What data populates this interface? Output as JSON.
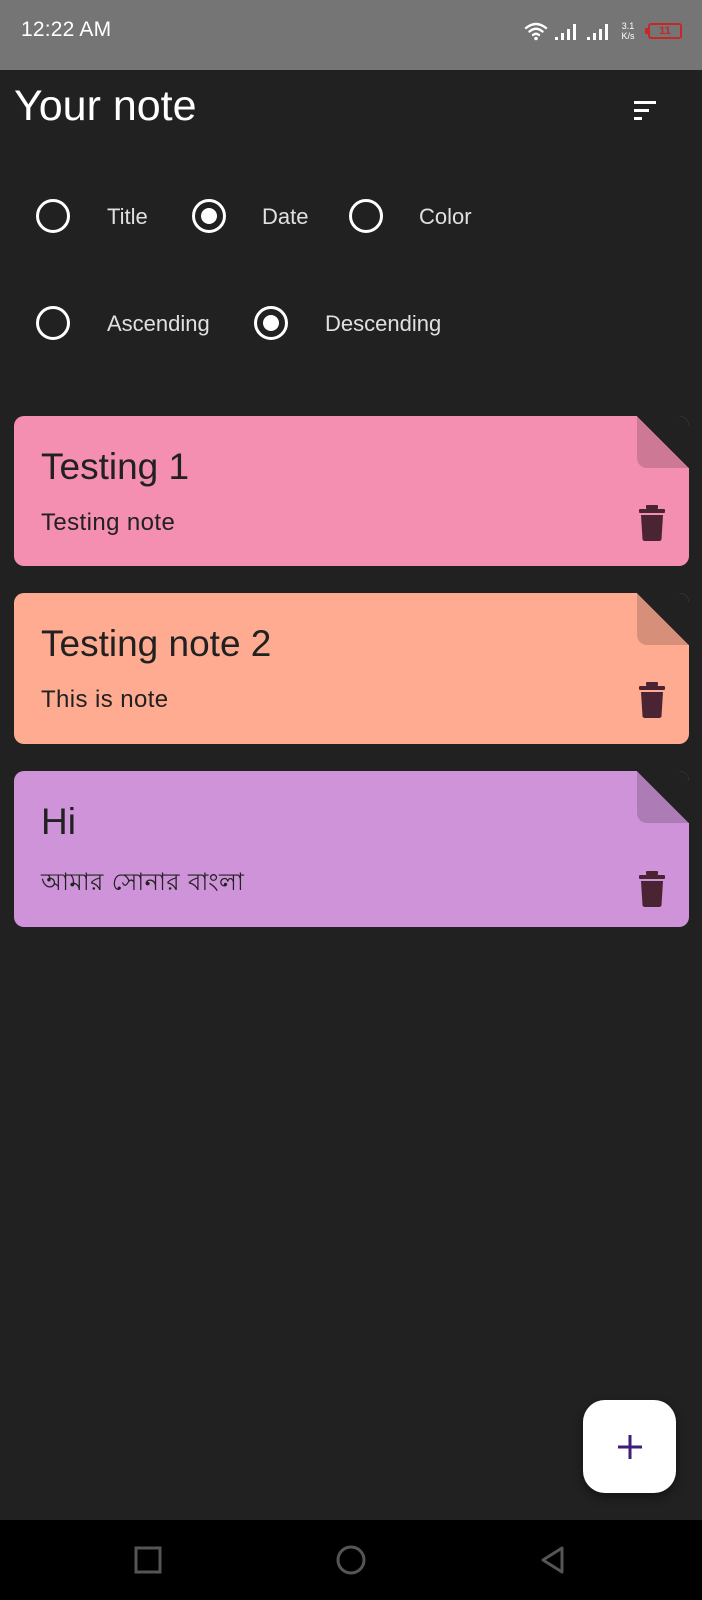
{
  "status_bar": {
    "time": "12:22 AM",
    "net_speed_value": "3.1",
    "net_speed_unit": "K/s",
    "battery_level": "11",
    "battery_color": "#c62828",
    "icons": [
      "wifi-icon",
      "signal-icon",
      "signal-icon",
      "battery-icon"
    ]
  },
  "header": {
    "title": "Your note",
    "sort_icon": "sort-icon"
  },
  "sort_by": {
    "options": [
      {
        "label": "Title",
        "selected": false
      },
      {
        "label": "Date",
        "selected": true
      },
      {
        "label": "Color",
        "selected": false
      }
    ]
  },
  "sort_order": {
    "options": [
      {
        "label": "Ascending",
        "selected": false
      },
      {
        "label": "Descending",
        "selected": true
      }
    ]
  },
  "notes": [
    {
      "title": "Testing 1",
      "content": "Testing note",
      "color": "#f48fb1"
    },
    {
      "title": "Testing note 2",
      "content": "This is note",
      "color": "#ffab91"
    },
    {
      "title": "Hi",
      "content": "আমার সোনার বাংলা",
      "color": "#ce93d8"
    }
  ],
  "delete_icon_color": "#4a2433",
  "fab": {
    "icon": "plus-icon",
    "icon_color": "#3f1d7a"
  },
  "nav_bar": {
    "icons": [
      "recent-apps-icon",
      "home-icon",
      "back-icon"
    ]
  }
}
